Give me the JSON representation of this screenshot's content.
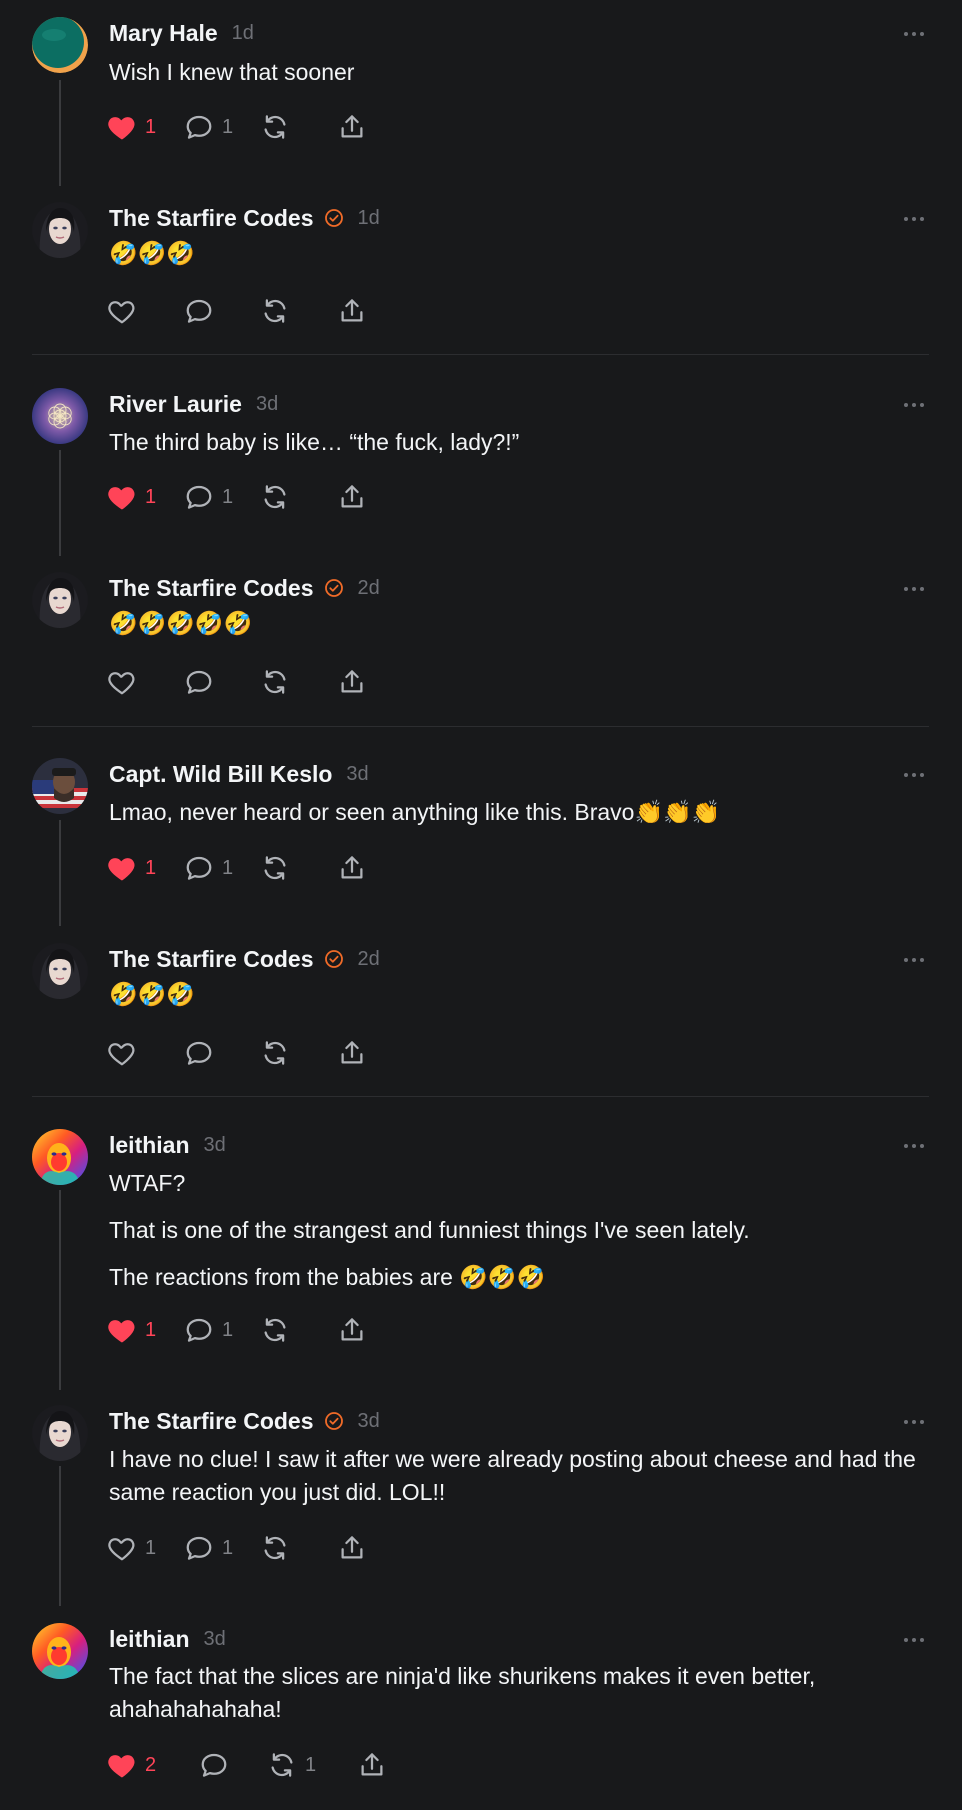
{
  "colors": {
    "background": "#18191b",
    "text": "#f3f5f7",
    "muted": "#818388",
    "like_active": "#ff4458",
    "verified_badge": "#f06b28",
    "divider": "#2c2d30"
  },
  "posts": [
    {
      "author": "Mary Hale",
      "time": "1d",
      "verified": false,
      "avatar_icon": "mary-hale-avatar",
      "lines": [
        "Wish I knew that sooner"
      ],
      "liked": true,
      "likes": "1",
      "replies": "1",
      "reposts": ""
    },
    {
      "author": "The Starfire Codes",
      "time": "1d",
      "verified": true,
      "avatar_icon": "starfire-avatar",
      "lines": [
        "🤣🤣🤣"
      ],
      "liked": false,
      "likes": "",
      "replies": "",
      "reposts": ""
    },
    {
      "author": "River Laurie",
      "time": "3d",
      "verified": false,
      "avatar_icon": "river-laurie-avatar",
      "lines": [
        "The third baby is like… “the fuck, lady?!”"
      ],
      "liked": true,
      "likes": "1",
      "replies": "1",
      "reposts": ""
    },
    {
      "author": "The Starfire Codes",
      "time": "2d",
      "verified": true,
      "avatar_icon": "starfire-avatar",
      "lines": [
        "🤣🤣🤣🤣🤣"
      ],
      "liked": false,
      "likes": "",
      "replies": "",
      "reposts": ""
    },
    {
      "author": "Capt. Wild Bill Keslo",
      "time": "3d",
      "verified": false,
      "avatar_icon": "wild-bill-avatar",
      "lines": [
        "Lmao, never heard or seen anything like this. Bravo👏👏👏"
      ],
      "liked": true,
      "likes": "1",
      "replies": "1",
      "reposts": ""
    },
    {
      "author": "The Starfire Codes",
      "time": "2d",
      "verified": true,
      "avatar_icon": "starfire-avatar",
      "lines": [
        "🤣🤣🤣"
      ],
      "liked": false,
      "likes": "",
      "replies": "",
      "reposts": ""
    },
    {
      "author": "leithian",
      "time": "3d",
      "verified": false,
      "avatar_icon": "leithian-avatar",
      "lines": [
        "WTAF?",
        "That is one of the strangest and funniest things I've seen lately.",
        "The reactions from the babies are 🤣🤣🤣"
      ],
      "liked": true,
      "likes": "1",
      "replies": "1",
      "reposts": ""
    },
    {
      "author": "The Starfire Codes",
      "time": "3d",
      "verified": true,
      "avatar_icon": "starfire-avatar",
      "lines": [
        "I have no clue! I saw it after we were already posting about cheese and had the same reaction you just did. LOL!!"
      ],
      "liked": false,
      "likes": "1",
      "replies": "1",
      "reposts": ""
    },
    {
      "author": "leithian",
      "time": "3d",
      "verified": false,
      "avatar_icon": "leithian-avatar",
      "lines": [
        "The fact that the slices are ninja'd like shurikens makes it even better, ahahahahahaha!"
      ],
      "liked": true,
      "likes": "2",
      "replies": "",
      "reposts": "1"
    }
  ]
}
